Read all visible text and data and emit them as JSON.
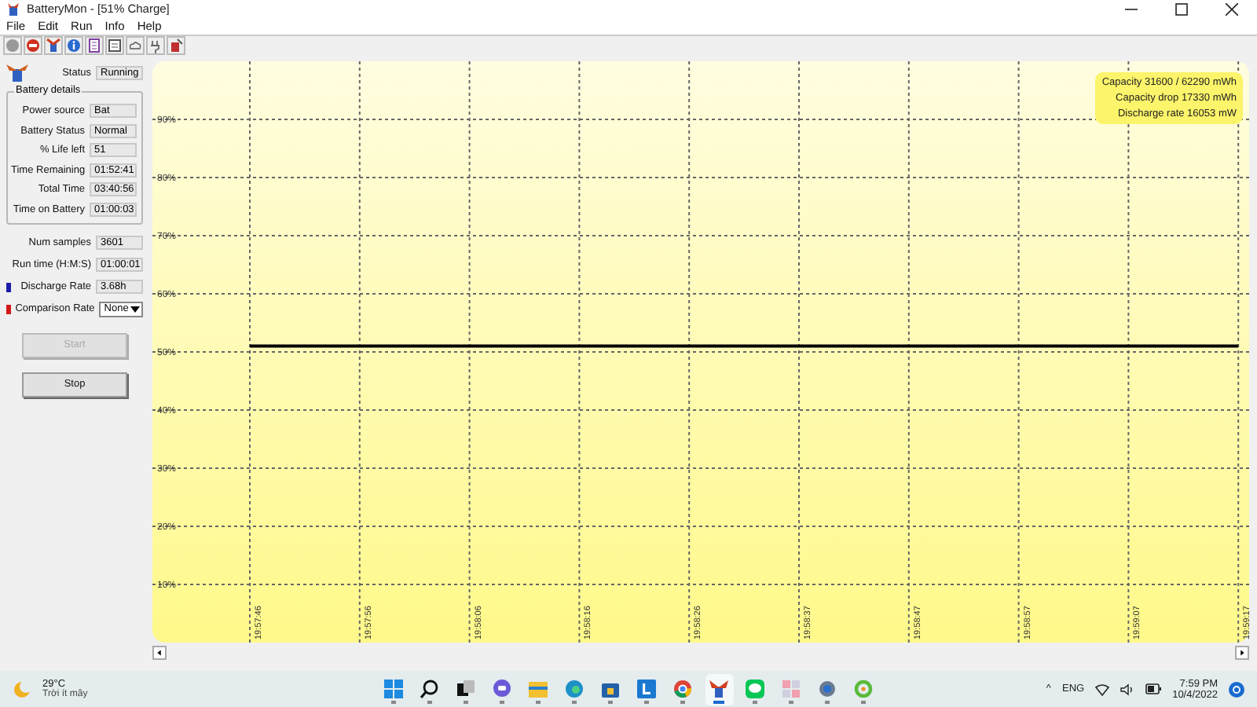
{
  "window": {
    "title": "BatteryMon - [51% Charge]"
  },
  "menu": [
    "File",
    "Edit",
    "Run",
    "Info",
    "Help"
  ],
  "status": {
    "label": "Status",
    "value": "Running"
  },
  "battery_details": {
    "title": "Battery details",
    "fields": [
      {
        "label": "Power source",
        "value": "Bat"
      },
      {
        "label": "Battery Status",
        "value": "Normal"
      },
      {
        "label": "% Life left",
        "value": "51"
      },
      {
        "label": "Time Remaining",
        "value": "01:52:41"
      },
      {
        "label": "Total Time",
        "value": "03:40:56"
      },
      {
        "label": "Time on Battery",
        "value": "01:00:03"
      }
    ]
  },
  "stats": [
    {
      "kind": "text",
      "label": "Num samples",
      "value": "3601"
    },
    {
      "kind": "text",
      "label": "Run time (H:M:S)",
      "value": "01:00:01"
    },
    {
      "kind": "text",
      "label": "Discharge Rate",
      "value": "3.68h",
      "color": "#1c1ca8"
    },
    {
      "kind": "dropdown",
      "label": "Comparison Rate",
      "value": "None",
      "color": "#d01818"
    }
  ],
  "buttons": [
    {
      "label": "Start",
      "disabled": true
    },
    {
      "label": "Stop",
      "disabled": false
    }
  ],
  "chart": {
    "info": [
      "Capacity 31600 / 62290 mWh",
      "Capacity drop 17330 mWh",
      "Discharge rate 16053 mW"
    ],
    "chart_data": {
      "type": "line",
      "categories": [
        "19:57:46",
        "19:57:56",
        "19:58:06",
        "19:58:16",
        "19:58:26",
        "19:58:37",
        "19:58:47",
        "19:58:57",
        "19:59:07",
        "19:59:17"
      ],
      "series": [
        {
          "color": "#000000",
          "values": [
            51,
            51,
            51,
            51,
            51,
            51,
            51,
            51,
            51,
            51
          ]
        }
      ],
      "ylim": [
        0,
        100
      ],
      "grid": true,
      "yticks": [
        {
          "value": 10,
          "label": "10%"
        },
        {
          "value": 20,
          "label": "20%"
        },
        {
          "value": 30,
          "label": "30%"
        },
        {
          "value": 40,
          "label": "40%"
        },
        {
          "value": 50,
          "label": "50%"
        },
        {
          "value": 60,
          "label": "60%"
        },
        {
          "value": 70,
          "label": "70%"
        },
        {
          "value": 80,
          "label": "80%"
        },
        {
          "value": 90,
          "label": "90%"
        }
      ]
    }
  },
  "taskbar": {
    "weather": {
      "temperature": "29°C",
      "condition": "Trời ít mây"
    },
    "apps": [
      {
        "kind": "start",
        "selected": false
      },
      {
        "kind": "search",
        "selected": false
      },
      {
        "kind": "taskview",
        "selected": false
      },
      {
        "kind": "chat",
        "selected": false
      },
      {
        "kind": "folder",
        "selected": false
      },
      {
        "kind": "browser",
        "selected": false
      },
      {
        "kind": "store",
        "selected": false
      },
      {
        "kind": "tile",
        "selected": false
      },
      {
        "kind": "chrome",
        "selected": false
      },
      {
        "kind": "battery",
        "selected": true
      },
      {
        "kind": "messenger",
        "selected": false
      },
      {
        "kind": "puzzle",
        "selected": false
      },
      {
        "kind": "settings",
        "selected": false
      },
      {
        "kind": "ring",
        "selected": false
      }
    ],
    "tray": {
      "chevron": "^",
      "language": "ENG",
      "time": "7:59 PM",
      "date": "10/4/2022"
    }
  }
}
